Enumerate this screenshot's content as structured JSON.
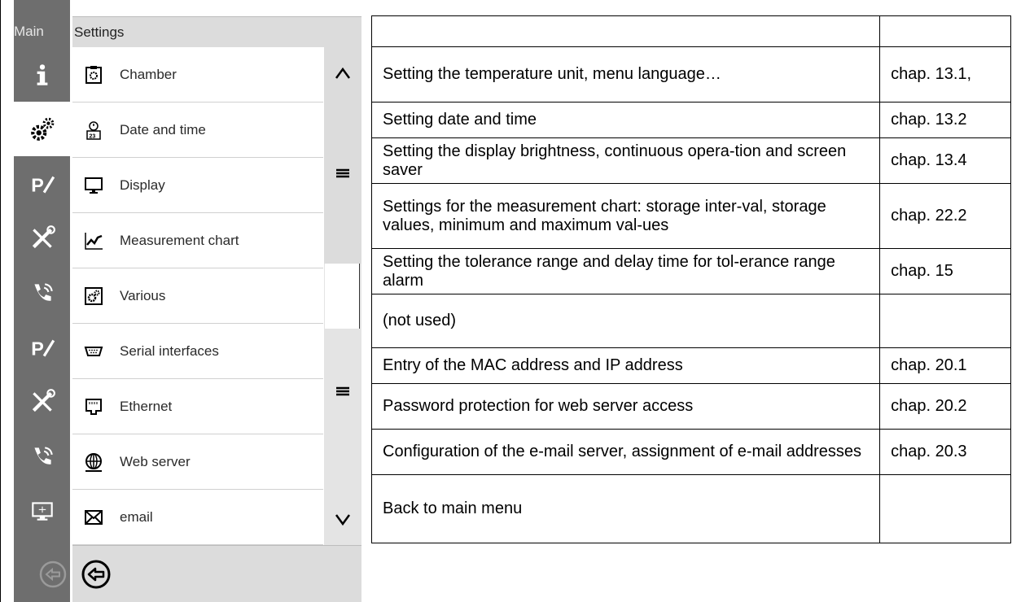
{
  "screen": {
    "main_tab": "Main",
    "title": "Settings",
    "rail_icons": [
      "info-icon",
      "settings-gears-icon",
      "program-edit-icon",
      "service-tools-icon",
      "phone-icon",
      "program-edit-icon",
      "service-tools-icon",
      "phone-icon",
      "display-screen-icon",
      "back-icon"
    ],
    "menu_items": [
      {
        "label": "Chamber",
        "icon": "chamber-icon"
      },
      {
        "label": "Date and time",
        "icon": "calendar-clock-icon"
      },
      {
        "label": "Display",
        "icon": "monitor-icon"
      },
      {
        "label": "Measurement chart",
        "icon": "line-chart-icon"
      },
      {
        "label": "Various",
        "icon": "various-gear-icon"
      },
      {
        "label": "Serial interfaces",
        "icon": "serial-port-icon"
      },
      {
        "label": "Ethernet",
        "icon": "ethernet-icon"
      },
      {
        "label": "Web server",
        "icon": "globe-icon"
      },
      {
        "label": "email",
        "icon": "envelope-icon"
      }
    ],
    "colors": {
      "rail": "#6e6e6e",
      "bar": "#dcdcdc",
      "list_bg": "#e4e4e4"
    }
  },
  "table": {
    "rows": [
      {
        "description": "",
        "chapter": ""
      },
      {
        "description": "Setting the temperature unit, menu language…",
        "chapter": "chap. 13.1,"
      },
      {
        "description": "Setting date and time",
        "chapter": "chap. 13.2"
      },
      {
        "description": "Setting the display brightness, continuous opera-tion and screen saver",
        "chapter": "chap. 13.4"
      },
      {
        "description": "Settings for the measurement chart: storage inter-val, storage values, minimum and maximum val-ues",
        "chapter": "chap. 22.2"
      },
      {
        "description": "Setting the tolerance range and delay time for tol-erance range alarm",
        "chapter": "chap. 15"
      },
      {
        "description": "(not used)",
        "chapter": ""
      },
      {
        "description": "Entry of the MAC address and IP address",
        "chapter": "chap. 20.1"
      },
      {
        "description": "Password protection for web server access",
        "chapter": "chap. 20.2"
      },
      {
        "description": "Configuration of the e-mail server, assignment of e-mail addresses",
        "chapter": "chap. 20.3"
      },
      {
        "description": "Back to main menu",
        "chapter": ""
      }
    ]
  }
}
